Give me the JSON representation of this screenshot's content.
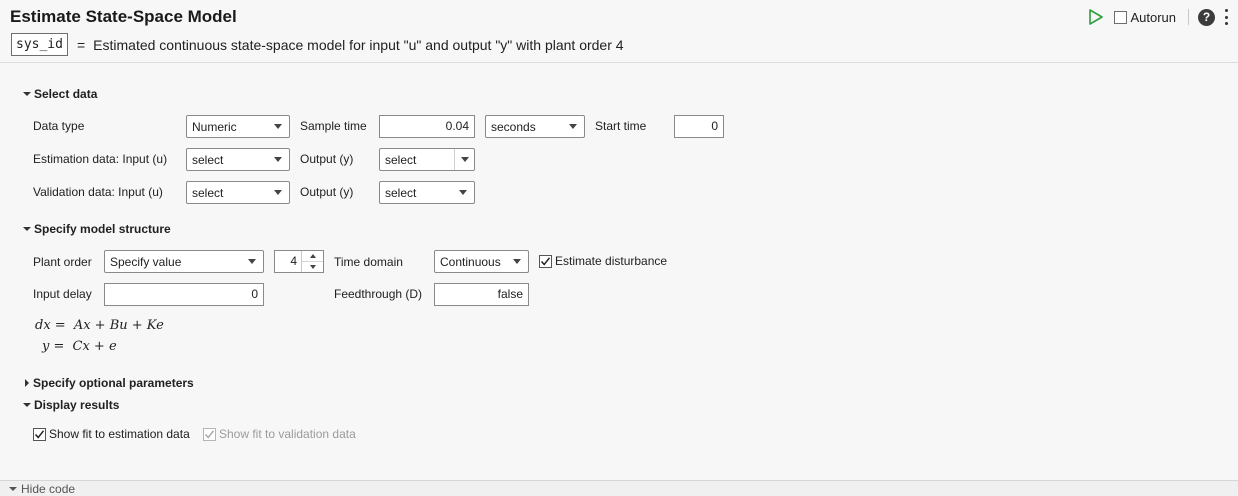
{
  "header": {
    "title": "Estimate State-Space Model",
    "var_name": "sys_id",
    "equals": "=",
    "summary": "Estimated continuous state-space model for input \"u\" and output \"y\" with plant order 4"
  },
  "toolbar": {
    "autorun_label": "Autorun",
    "autorun_checked": false,
    "help_label": "?",
    "run_icon": "play-icon",
    "more_icon": "vertical-ellipsis-icon",
    "accent_color": "#2e9e3e"
  },
  "select_data": {
    "title": "Select data",
    "data_type_label": "Data type",
    "data_type_value": "Numeric",
    "sample_time_label": "Sample time",
    "sample_time_value": "0.04",
    "time_unit_value": "seconds",
    "start_time_label": "Start time",
    "start_time_value": "0",
    "estimation_input_label": "Estimation data: Input (u)",
    "estimation_input_value": "select",
    "estimation_output_label": "Output (y)",
    "estimation_output_value": "select",
    "validation_input_label": "Validation data: Input (u)",
    "validation_input_value": "select",
    "validation_output_label": "Output (y)",
    "validation_output_value": "select"
  },
  "model_structure": {
    "title": "Specify model structure",
    "plant_order_label": "Plant order",
    "plant_order_mode": "Specify value",
    "plant_order_value": "4",
    "time_domain_label": "Time domain",
    "time_domain_value": "Continuous",
    "estimate_disturbance_label": "Estimate disturbance",
    "estimate_disturbance_checked": true,
    "input_delay_label": "Input delay",
    "input_delay_value": "0",
    "feedthrough_label": "Feedthrough (D)",
    "feedthrough_value": "false",
    "equation_1_lhs": "dx =",
    "equation_1_rhs": "Ax + Bu + Ke",
    "equation_2_lhs": "y =",
    "equation_2_rhs": "Cx + e"
  },
  "optional_params": {
    "title": "Specify optional parameters",
    "expanded": false
  },
  "display_results": {
    "title": "Display results",
    "fit_estimation_label": "Show fit to estimation data",
    "fit_estimation_checked": true,
    "fit_validation_label": "Show fit to validation data",
    "fit_validation_checked": true,
    "fit_validation_enabled": false
  },
  "footer": {
    "hide_code_label": "Hide code"
  }
}
